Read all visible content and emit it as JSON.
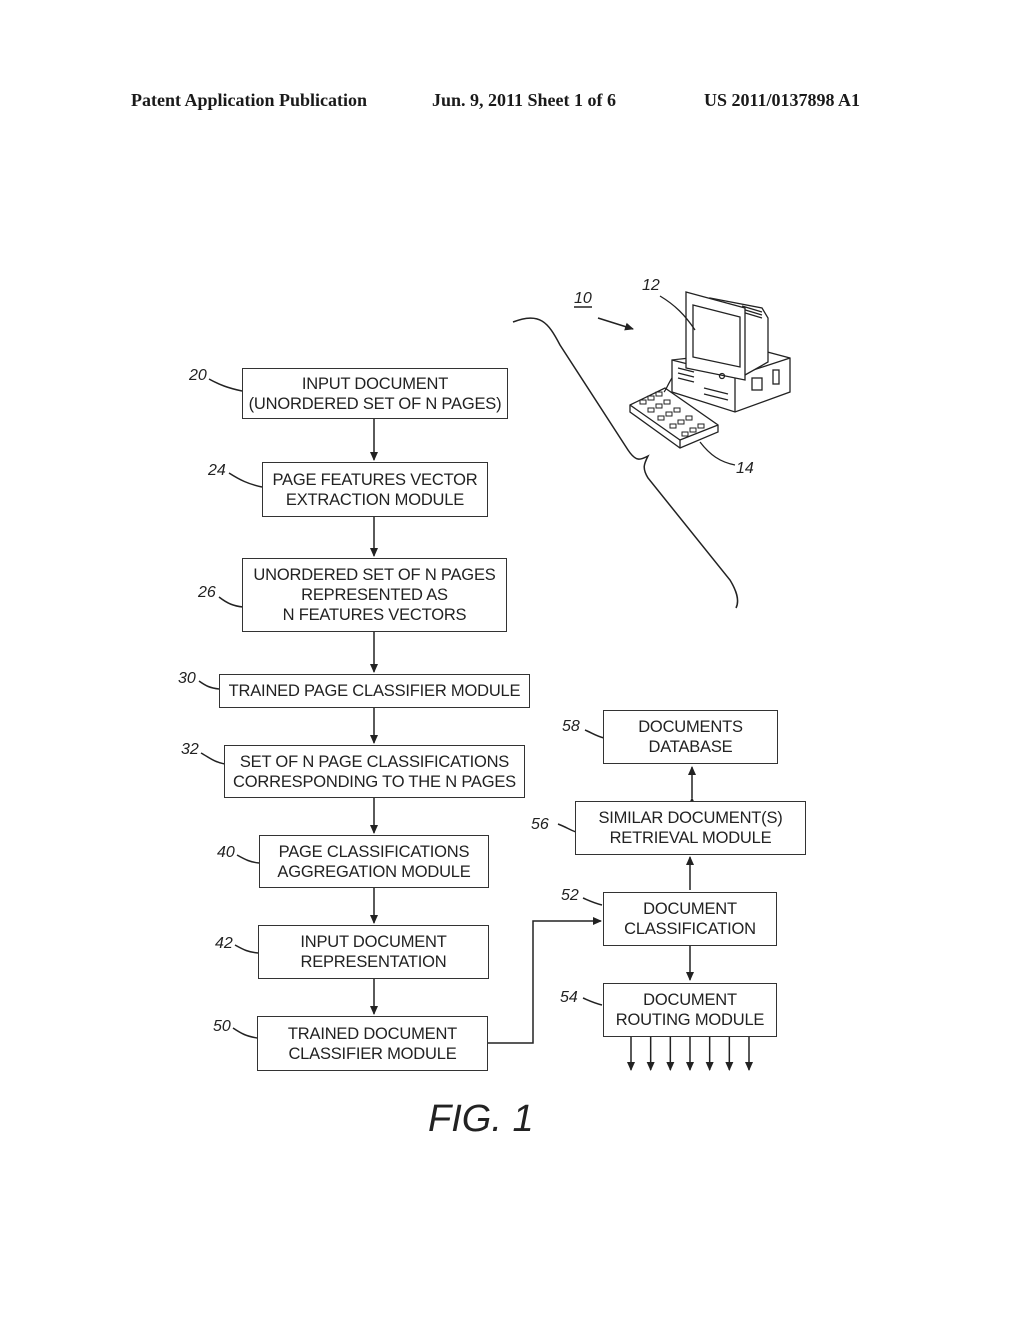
{
  "header": {
    "publication": "Patent Application Publication",
    "date_sheet": "Jun. 9, 2011   Sheet 1 of 6",
    "number": "US 2011/0137898 A1"
  },
  "figure_label": "FIG. 1",
  "system": {
    "ref": "10",
    "monitor_ref": "12",
    "keyboard_ref": "14",
    "icon": "computer-workstation-icon"
  },
  "boxes": {
    "b20": {
      "ref": "20",
      "lines": [
        "INPUT DOCUMENT",
        "(UNORDERED SET OF N PAGES)"
      ]
    },
    "b24": {
      "ref": "24",
      "lines": [
        "PAGE FEATURES VECTOR",
        "EXTRACTION MODULE"
      ]
    },
    "b26": {
      "ref": "26",
      "lines": [
        "UNORDERED SET OF N PAGES",
        "REPRESENTED AS",
        "N FEATURES VECTORS"
      ]
    },
    "b30": {
      "ref": "30",
      "lines": [
        "TRAINED PAGE CLASSIFIER MODULE"
      ]
    },
    "b32": {
      "ref": "32",
      "lines": [
        "SET OF N PAGE CLASSIFICATIONS",
        "CORRESPONDING TO THE N PAGES"
      ]
    },
    "b40": {
      "ref": "40",
      "lines": [
        "PAGE CLASSIFICATIONS",
        "AGGREGATION MODULE"
      ]
    },
    "b42": {
      "ref": "42",
      "lines": [
        "INPUT DOCUMENT",
        "REPRESENTATION"
      ]
    },
    "b50": {
      "ref": "50",
      "lines": [
        "TRAINED DOCUMENT",
        "CLASSIFIER MODULE"
      ]
    },
    "b52": {
      "ref": "52",
      "lines": [
        "DOCUMENT",
        "CLASSIFICATION"
      ]
    },
    "b54": {
      "ref": "54",
      "lines": [
        "DOCUMENT",
        "ROUTING MODULE"
      ]
    },
    "b56": {
      "ref": "56",
      "lines": [
        "SIMILAR DOCUMENT(S)",
        "RETRIEVAL MODULE"
      ]
    },
    "b58": {
      "ref": "58",
      "lines": [
        "DOCUMENTS",
        "DATABASE"
      ]
    }
  },
  "routing_outputs": 7
}
